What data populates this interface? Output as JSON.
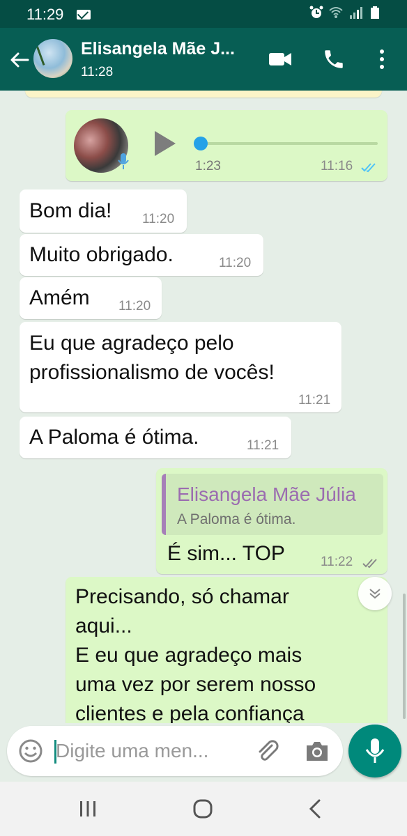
{
  "status_bar": {
    "time": "11:29"
  },
  "header": {
    "title": "Elisangela Mãe J...",
    "subtitle": "11:28"
  },
  "colors": {
    "header": "#075e54",
    "status_bar": "#054d44",
    "incoming": "#ffffff",
    "outgoing": "#dcf8c6",
    "accent": "#00897b",
    "quote_author": "#9b6cb0",
    "read_tick": "#4fc3f7"
  },
  "voice_message": {
    "duration": "1:23",
    "time": "11:16",
    "status": "read"
  },
  "messages": [
    {
      "text": "Bom dia!",
      "time": "11:20",
      "direction": "in"
    },
    {
      "text": "Muito obrigado.",
      "time": "11:20",
      "direction": "in"
    },
    {
      "text": "Amém",
      "time": "11:20",
      "direction": "in"
    },
    {
      "text": "Eu que agradeço pelo profissionalismo de vocês!",
      "line1": "Eu que agradeço pelo",
      "line2": "profissionalismo de vocês!",
      "time": "11:21",
      "direction": "in"
    },
    {
      "text": "A Paloma é ótima.",
      "time": "11:21",
      "direction": "in"
    }
  ],
  "reply": {
    "quoted_author": "Elisangela Mãe Júlia",
    "quoted_text": "A Paloma é ótima.",
    "text": "É sim... TOP",
    "time": "11:22",
    "status": "delivered"
  },
  "last_message": {
    "lines": [
      "Precisando, só chamar",
      "aqui...",
      "E eu que agradeço mais",
      "uma vez por serem nosso",
      "clientes e pela confiança"
    ]
  },
  "input": {
    "placeholder": "Digite uma men..."
  },
  "icons": [
    "back-arrow-icon",
    "video-call-icon",
    "phone-icon",
    "more-vert-icon",
    "play-icon",
    "mic-icon",
    "emoji-icon",
    "attach-icon",
    "camera-icon",
    "chevron-down-icon",
    "recent-apps-icon",
    "home-icon",
    "nav-back-icon"
  ]
}
